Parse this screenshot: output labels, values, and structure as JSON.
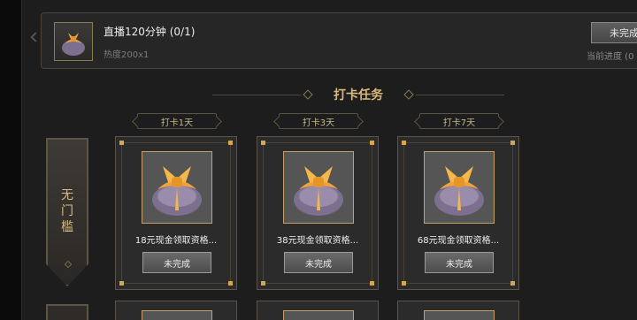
{
  "task": {
    "title": "直播120分钟 (0/1)",
    "subtitle": "热度200x1",
    "status_button": "未完成",
    "progress_label": "当前进度 (0"
  },
  "section": {
    "title": "打卡任务"
  },
  "banner": {
    "label": "无门槛"
  },
  "days": [
    {
      "tag": "打卡1天",
      "reward": "18元现金领取资格...",
      "status": "未完成"
    },
    {
      "tag": "打卡3天",
      "reward": "38元现金领取资格...",
      "status": "未完成"
    },
    {
      "tag": "打卡7天",
      "reward": "68元现金领取资格...",
      "status": "未完成"
    }
  ],
  "icons": {
    "reward_bag": "gift-bag-icon",
    "back_arrow": "chevron-left-icon"
  },
  "colors": {
    "accent_gold": "#d8b97c",
    "bag_orange": "#f2a23a",
    "bag_purple": "#7d6f8f"
  }
}
